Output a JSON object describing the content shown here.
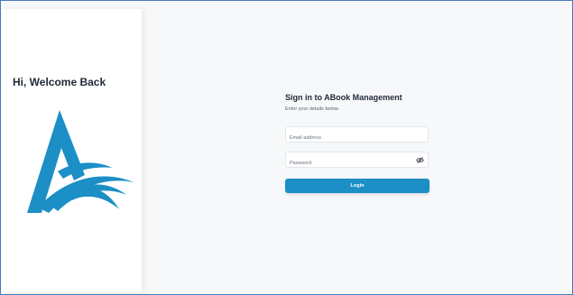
{
  "left": {
    "welcome": "Hi, Welcome Back",
    "logo_icon": "abook-logo-icon",
    "brand_color": "#1b8fc6"
  },
  "form": {
    "title": "Sign in to ABook Management",
    "subtitle": "Enter your details below.",
    "email": {
      "placeholder": "Email address",
      "value": ""
    },
    "password": {
      "placeholder": "Password",
      "value": "",
      "toggle_icon": "eye-off-icon"
    },
    "login_label": "Login"
  }
}
